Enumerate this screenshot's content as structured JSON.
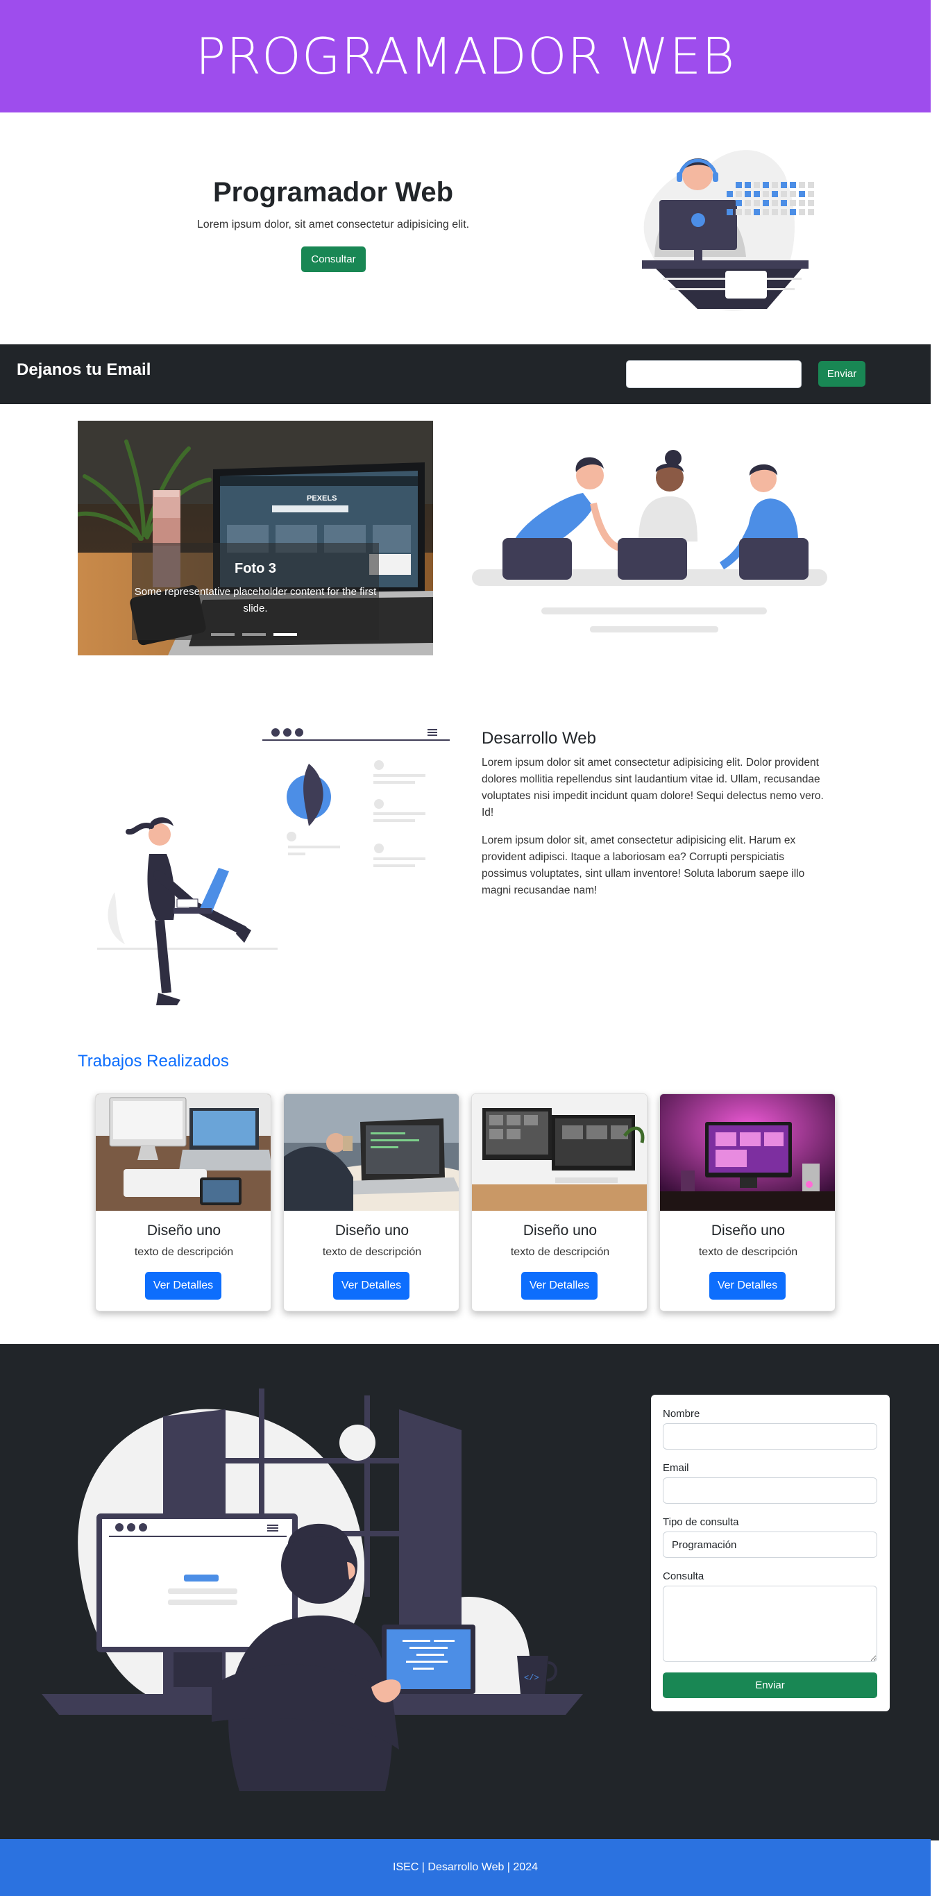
{
  "header": {
    "title": "PROGRAMADOR WEB"
  },
  "hero": {
    "title": "Programador Web",
    "subtitle": "Lorem ipsum dolor, sit amet consectetur adipisicing elit.",
    "button": "Consultar"
  },
  "email_bar": {
    "label": "Dejanos tu Email",
    "input_value": "",
    "button": "Enviar"
  },
  "carousel": {
    "screen_brand": "PEXELS",
    "caption_title": "Foto 3",
    "caption_text": "Some representative placeholder content for the first slide.",
    "slides": 3,
    "active_slide": 3
  },
  "about": {
    "title": "Desarrollo Web",
    "paragraph1": "Lorem ipsum dolor sit amet consectetur adipisicing elit. Dolor provident dolores mollitia repellendus sint laudantium vitae id. Ullam, recusandae voluptates nisi impedit incidunt quam dolore! Sequi delectus nemo vero. Id!",
    "paragraph2": "Lorem ipsum dolor sit, amet consectetur adipisicing elit. Harum ex provident adipisci. Itaque a laboriosam ea? Corrupti perspiciatis possimus voluptates, sint ullam inventore! Soluta laborum saepe illo magni recusandae nam!"
  },
  "works": {
    "title": "Trabajos Realizados",
    "cards": [
      {
        "title": "Diseño uno",
        "description": "texto de descripción",
        "button": "Ver Detalles"
      },
      {
        "title": "Diseño uno",
        "description": "texto de descripción",
        "button": "Ver Detalles"
      },
      {
        "title": "Diseño uno",
        "description": "texto de descripción",
        "button": "Ver Detalles"
      },
      {
        "title": "Diseño uno",
        "description": "texto de descripción",
        "button": "Ver Detalles"
      }
    ]
  },
  "contact_form": {
    "name_label": "Nombre",
    "name_value": "",
    "email_label": "Email",
    "email_value": "",
    "type_label": "Tipo de consulta",
    "type_selected": "Programación",
    "message_label": "Consulta",
    "message_value": "",
    "submit": "Enviar"
  },
  "footer": {
    "text": "ISEC | Desarrollo Web | 2024"
  },
  "colors": {
    "header_bg": "#9e4ded",
    "dark_bg": "#212529",
    "footer_bg": "#2b72e0",
    "success": "#198754",
    "primary": "#0d6efd",
    "illustration_accent": "#4c8ee6",
    "illustration_dark": "#3f3d56"
  }
}
